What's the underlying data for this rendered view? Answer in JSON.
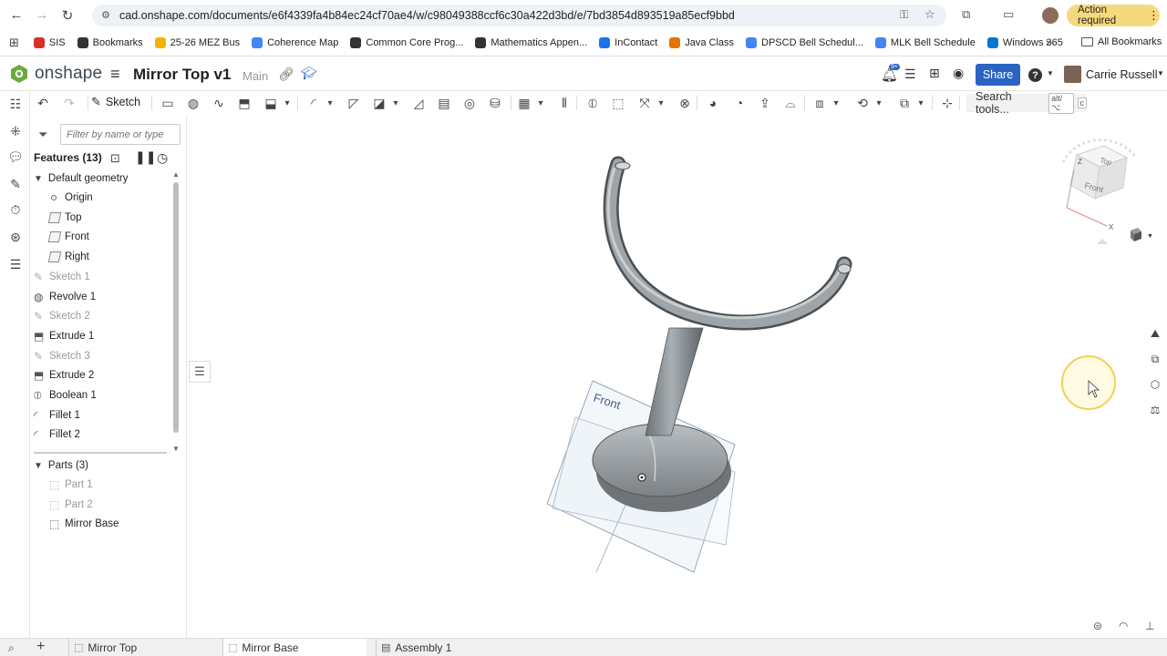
{
  "browser": {
    "url": "cad.onshape.com/documents/e6f4339fa4b84ec24cf70ae4/w/c98049388ccf6c30a422d3bd/e/7bd3854d893519a85ecf9bbd",
    "action_required": "Action required",
    "bookmarks": [
      {
        "label": "SIS",
        "color": "#d93025"
      },
      {
        "label": "Bookmarks",
        "color": "#333333"
      },
      {
        "label": "25-26 MEZ Bus",
        "color": "#f4b400"
      },
      {
        "label": "Coherence Map",
        "color": "#4285f4"
      },
      {
        "label": "Common Core Prog...",
        "color": "#333333"
      },
      {
        "label": "Mathematics Appen...",
        "color": "#333333"
      },
      {
        "label": "InContact",
        "color": "#1a73e8"
      },
      {
        "label": "Java Class",
        "color": "#e37400"
      },
      {
        "label": "DPSCD Bell Schedul...",
        "color": "#4285f4"
      },
      {
        "label": "MLK Bell Schedule",
        "color": "#4285f4"
      },
      {
        "label": "Windows 365",
        "color": "#0078d4"
      }
    ],
    "more": "»",
    "all_bookmarks": "All Bookmarks"
  },
  "app": {
    "logo": "onshape",
    "doc_title": "Mirror Top v1",
    "workspace": "Main",
    "share_label": "Share",
    "user_name": "Carrie Russell",
    "notification_count": "9+",
    "accent": "#2b63c4",
    "logo_color": "#6bab3e"
  },
  "toolbar": {
    "sketch_label": "Sketch",
    "search_label": "Search tools...",
    "shortcut_1": "alt/⌥",
    "shortcut_2": "c"
  },
  "panel": {
    "filter_placeholder": "Filter by name or type",
    "features_header": "Features (13)",
    "default_geometry": "Default geometry",
    "items": [
      {
        "label": "Origin"
      },
      {
        "label": "Top"
      },
      {
        "label": "Front"
      },
      {
        "label": "Right"
      },
      {
        "label": "Sketch 1"
      },
      {
        "label": "Revolve 1"
      },
      {
        "label": "Sketch 2"
      },
      {
        "label": "Extrude 1"
      },
      {
        "label": "Sketch 3"
      },
      {
        "label": "Extrude 2"
      },
      {
        "label": "Boolean 1"
      },
      {
        "label": "Fillet 1"
      },
      {
        "label": "Fillet 2"
      }
    ],
    "parts_header": "Parts (3)",
    "parts": [
      {
        "label": "Part 1"
      },
      {
        "label": "Part 2"
      },
      {
        "label": "Mirror Base"
      }
    ]
  },
  "viewport": {
    "plane_label": "Front",
    "view_cube": {
      "top": "Top",
      "front": "Front",
      "z": "Z",
      "x": "X"
    }
  },
  "tabs": [
    {
      "label": "Mirror Top"
    },
    {
      "label": "Mirror Base"
    },
    {
      "label": "Assembly 1"
    }
  ]
}
